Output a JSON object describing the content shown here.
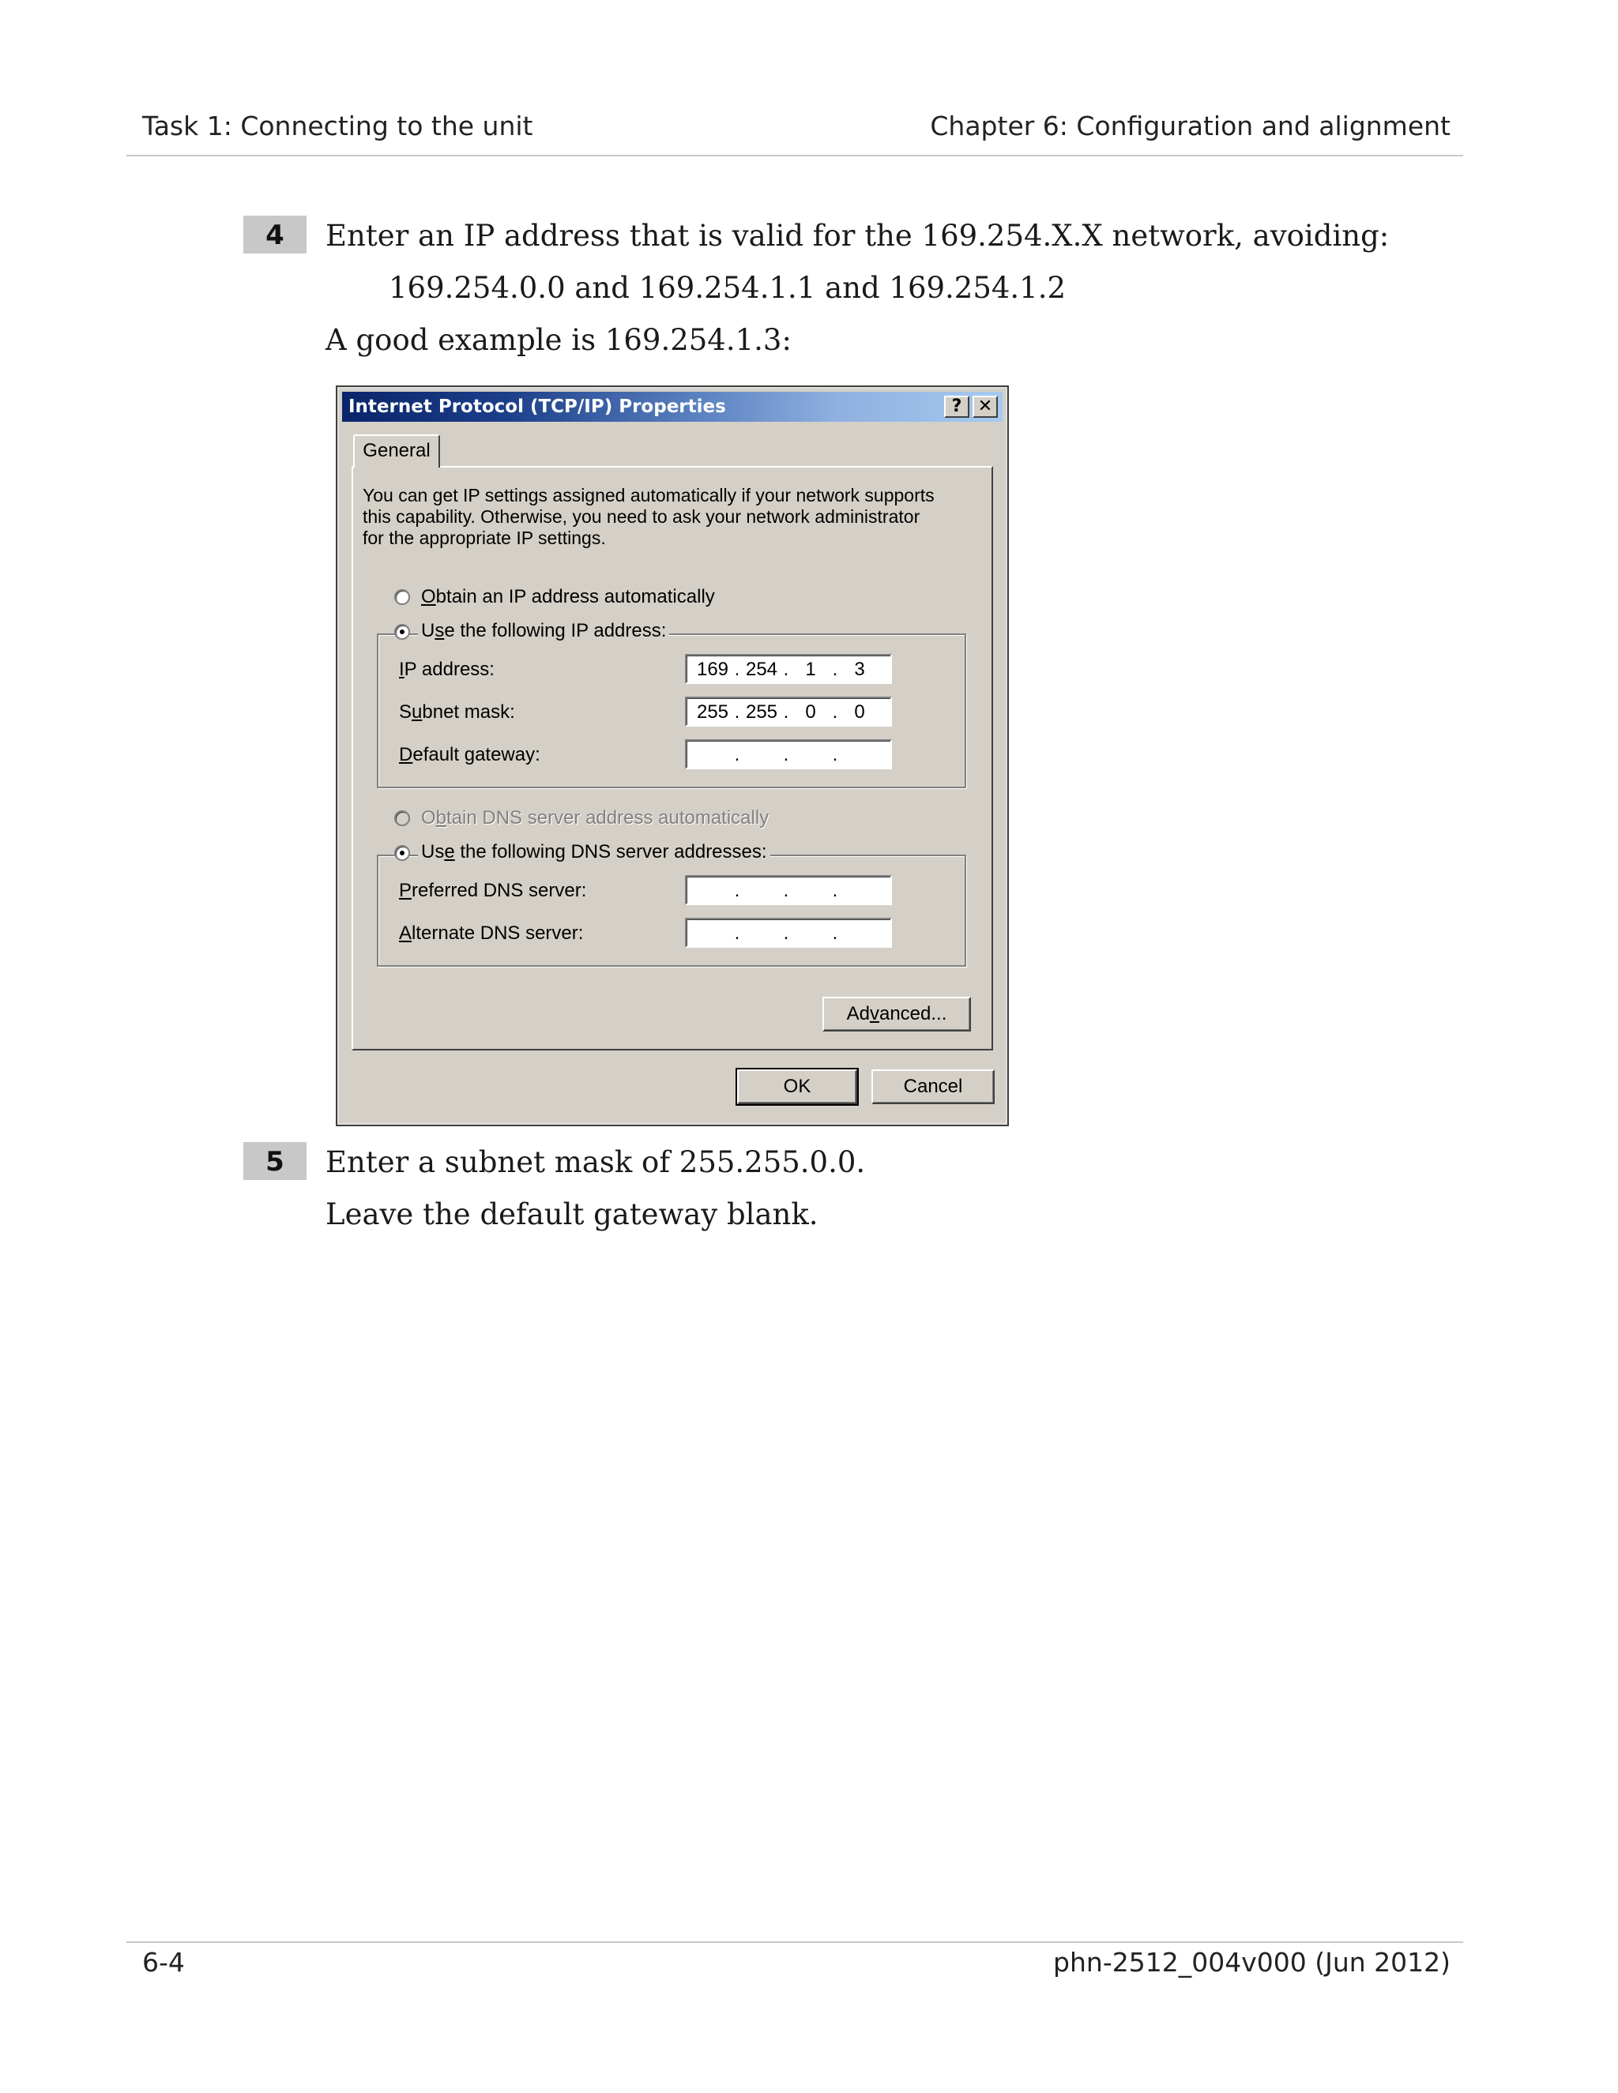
{
  "header": {
    "left": "Task 1: Connecting to the unit",
    "right": "Chapter 6:  Configuration and alignment"
  },
  "steps": [
    {
      "number": "4",
      "text": "Enter an IP address that is valid for the 169.254.X.X network, avoiding:",
      "indent_text": "169.254.0.0 and 169.254.1.1 and 169.254.1.2",
      "followup": "A good example is 169.254.1.3:"
    },
    {
      "number": "5",
      "text": "Enter a subnet mask of 255.255.0.0.",
      "followup": "Leave the default gateway blank."
    }
  ],
  "dialog": {
    "title": "Internet Protocol (TCP/IP) Properties",
    "help_glyph": "?",
    "close_glyph": "✕",
    "tab": "General",
    "intro": "You can get IP settings assigned automatically if your network supports this capability. Otherwise, you need to ask your network administrator for the appropriate IP settings.",
    "radio_obtain_ip": {
      "pre": "",
      "accel": "O",
      "post": "btain an IP address automatically"
    },
    "radio_use_ip": {
      "pre": "U",
      "accel": "s",
      "post": "e the following IP address:"
    },
    "fields": {
      "ip": {
        "pre": "",
        "accel": "I",
        "post": "P address:",
        "octets": [
          "169",
          "254",
          "1",
          "3"
        ]
      },
      "subnet": {
        "pre": "S",
        "accel": "u",
        "post": "bnet mask:",
        "octets": [
          "255",
          "255",
          "0",
          "0"
        ]
      },
      "gateway": {
        "pre": "",
        "accel": "D",
        "post": "efault gateway:",
        "octets": [
          "",
          "",
          "",
          ""
        ]
      }
    },
    "radio_obtain_dns": {
      "pre": "O",
      "accel": "b",
      "post": "tain DNS server address automatically"
    },
    "radio_use_dns": {
      "pre": "Us",
      "accel": "e",
      "post": " the following DNS server addresses:"
    },
    "dns": {
      "preferred": {
        "pre": "",
        "accel": "P",
        "post": "referred DNS server:",
        "octets": [
          "",
          "",
          "",
          ""
        ]
      },
      "alternate": {
        "pre": "",
        "accel": "A",
        "post": "lternate DNS server:",
        "octets": [
          "",
          "",
          "",
          ""
        ]
      }
    },
    "dot": ".",
    "advanced": {
      "pre": "Ad",
      "accel": "v",
      "post": "anced..."
    },
    "ok": "OK",
    "cancel": "Cancel"
  },
  "footer": {
    "left": "6-4",
    "right": "phn-2512_004v000 (Jun 2012)"
  }
}
